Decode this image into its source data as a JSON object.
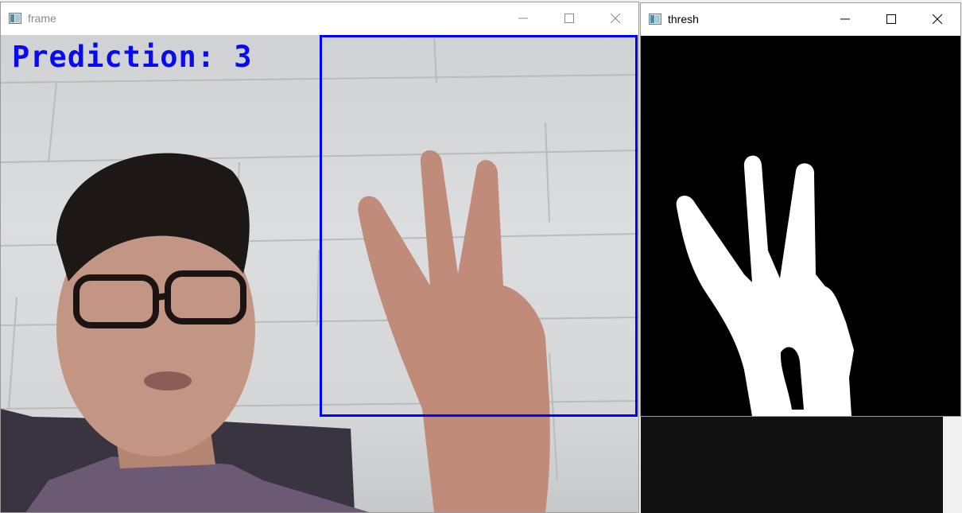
{
  "windows": {
    "frame": {
      "title": "frame",
      "overlay": {
        "prediction_text": "Prediction: 3"
      }
    },
    "thresh": {
      "title": "thresh"
    }
  },
  "icons": {
    "app": "app-window-icon",
    "minimize": "minimize-icon",
    "maximize": "maximize-icon",
    "close": "close-icon"
  },
  "colors": {
    "overlay_text": "#0a0af0",
    "roi_box": "#0000ff",
    "threshold_background": "#000000",
    "threshold_foreground": "#ffffff"
  }
}
